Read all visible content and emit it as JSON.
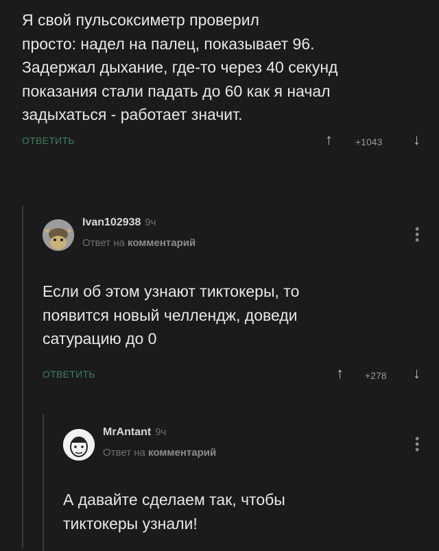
{
  "top_comment": {
    "text": "Я свой пульсоксиметр проверил\nпросто: надел на палец, показывает 96.\nЗадержал дыхание, где-то через 40 секунд\nпоказания стали падать до 60 как я начал\nзадыхаться - работает значит.",
    "reply_label": "ОТВЕТИТЬ",
    "score": "+1043"
  },
  "reply1": {
    "author": "Ivan102938",
    "time": "9ч",
    "reply_to_prefix": "Ответ на",
    "reply_to_target": "комментарий",
    "text": "Если об этом узнают тиктокеры, то\nпоявится новый челлендж, доведи\nсатурацию до 0",
    "reply_label": "ОТВЕТИТЬ",
    "score": "+278"
  },
  "reply2": {
    "author": "MrAntant",
    "time": "9ч",
    "reply_to_prefix": "Ответ на",
    "reply_to_target": "комментарий",
    "text": "А давайте сделаем так, чтобы\nтиктокеры узнали!"
  },
  "icons": {
    "up": "↑",
    "down": "↓",
    "menu": "⋮"
  }
}
